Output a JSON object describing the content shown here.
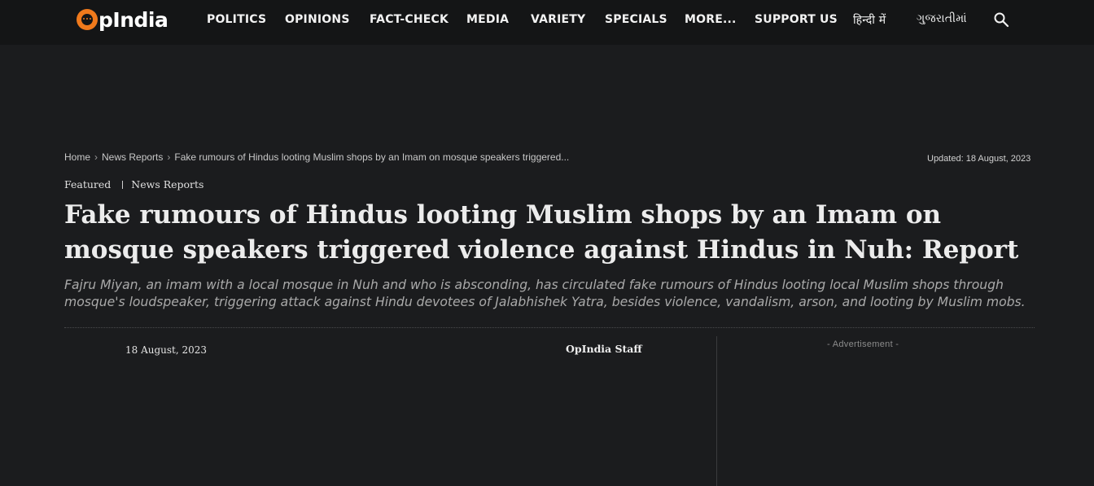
{
  "header": {
    "logo_text": "pIndia",
    "nav": [
      {
        "label": "POLITICS"
      },
      {
        "label": "OPINIONS"
      },
      {
        "label": "FACT-CHECK"
      },
      {
        "label": "MEDIA"
      },
      {
        "label": "VARIETY"
      },
      {
        "label": "SPECIALS"
      },
      {
        "label": "MORE..."
      },
      {
        "label": "SUPPORT US"
      },
      {
        "label": "हिन्दी में"
      },
      {
        "label": "ગુજરાતીમાં"
      }
    ],
    "search_icon": "search-icon"
  },
  "breadcrumb": {
    "home": "Home",
    "section": "News Reports",
    "current": "Fake rumours of Hindus looting Muslim shops by an Imam on mosque speakers triggered..."
  },
  "updated": "Updated: 18 August, 2023",
  "categories": [
    "Featured",
    "News Reports"
  ],
  "article": {
    "title": "Fake rumours of Hindus looting Muslim shops by an Imam on mosque speakers triggered violence against Hindus in Nuh: Report",
    "subtitle": "Fajru Miyan, an imam with a local mosque in Nuh and who is absconding, has circulated fake rumours of Hindus looting local Muslim shops through mosque's loudspeaker, triggering attack against Hindu devotees of Jalabhishek Yatra, besides violence, vandalism, arson, and looting by Muslim mobs.",
    "date": "18 August, 2023",
    "author": "OpIndia Staff"
  },
  "sidebar": {
    "ad_label": "- Advertisement -"
  },
  "colors": {
    "background": "#1b1c1e",
    "topbar": "#141516",
    "logo_accent": "#f07a1c"
  }
}
